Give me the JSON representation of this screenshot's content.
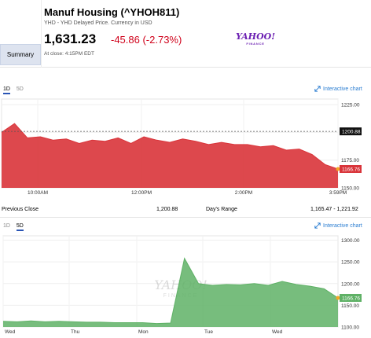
{
  "header": {
    "title": "Manuf Housing (^YHOH811)",
    "subtitle": "YHD - YHD Delayed Price. Currency in USD",
    "price": "1,631.23",
    "change": "-45.86 (-2.73%)",
    "close_time": "At close: 4:15PM EDT",
    "summary_tab": "Summary",
    "logo_main": "YAHOO!",
    "logo_sub": "FINANCE"
  },
  "chart1": {
    "tabs": [
      "1D",
      "5D"
    ],
    "active_tab": "1D",
    "interactive_label": "Interactive chart",
    "y_ticks": [
      "1225.00",
      "1200.00",
      "1175.00",
      "1150.00"
    ],
    "x_ticks": [
      "10:00AM",
      "12:00PM",
      "2:00PM",
      "3:59PM"
    ],
    "prev_close_tag": "1200.88",
    "last_tag": "1166.76",
    "color_fill": "#d9343a",
    "chart_data": {
      "type": "area",
      "ylim": [
        1150,
        1230
      ],
      "x": [
        "9:30",
        "9:45",
        "10:00",
        "10:15",
        "10:30",
        "10:45",
        "11:00",
        "11:15",
        "11:30",
        "11:45",
        "12:00",
        "12:15",
        "12:30",
        "12:45",
        "13:00",
        "13:15",
        "13:30",
        "13:45",
        "14:00",
        "14:15",
        "14:30",
        "14:45",
        "15:00",
        "15:15",
        "15:30",
        "15:45",
        "15:59"
      ],
      "values": [
        1200,
        1208,
        1195,
        1196,
        1193,
        1194,
        1190,
        1193,
        1192,
        1195,
        1190,
        1196,
        1193,
        1191,
        1194,
        1192,
        1189,
        1191,
        1189,
        1189,
        1187,
        1188,
        1184,
        1185,
        1180,
        1171,
        1167
      ],
      "reference_line": 1200.88
    }
  },
  "stats": {
    "prev_close_label": "Previous Close",
    "prev_close_value": "1,200.88",
    "days_range_label": "Day's Range",
    "days_range_value": "1,165.47 - 1,221.92"
  },
  "chart2": {
    "tabs": [
      "1D",
      "5D"
    ],
    "active_tab": "5D",
    "interactive_label": "Interactive chart",
    "y_ticks": [
      "1300.00",
      "1250.00",
      "1200.00",
      "1150.00",
      "1100.00"
    ],
    "x_ticks": [
      "Wed",
      "Thu",
      "Mon",
      "Tue",
      "Wed"
    ],
    "last_tag": "1166.76",
    "watermark_main": "YAHOO!",
    "watermark_sub": "FINANCE",
    "color_fill": "#5fb166",
    "chart_data": {
      "type": "area",
      "ylim": [
        1100,
        1310
      ],
      "x": [
        "Wed",
        "",
        "",
        "",
        "Thu",
        "",
        "",
        "",
        "Mon",
        "",
        "",
        "",
        "Tue",
        "",
        "",
        "",
        "",
        "",
        "",
        "",
        "Wed",
        "",
        "",
        "",
        ""
      ],
      "values": [
        1113,
        1112,
        1114,
        1112,
        1113,
        1112,
        1111,
        1111,
        1110,
        1110,
        1110,
        1108,
        1109,
        1258,
        1200,
        1196,
        1198,
        1197,
        1200,
        1196,
        1205,
        1198,
        1194,
        1188,
        1167
      ]
    }
  }
}
